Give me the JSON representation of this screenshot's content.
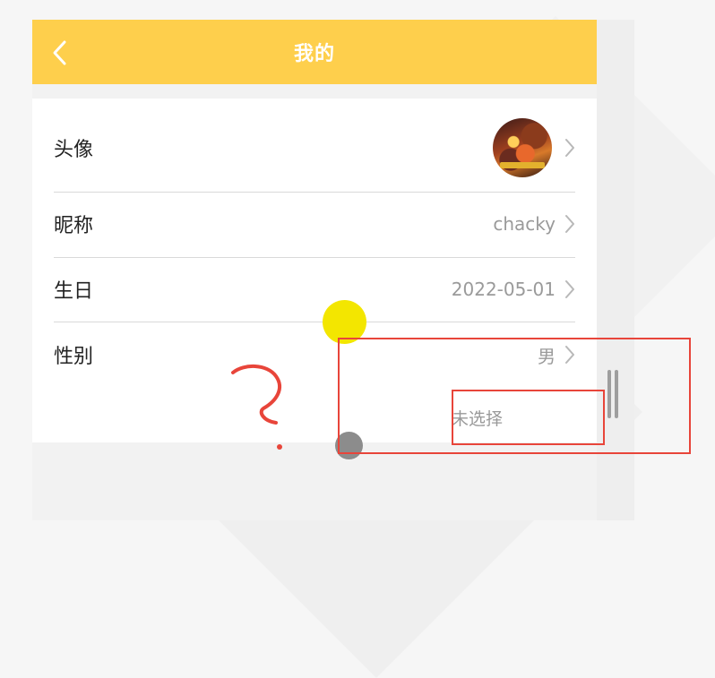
{
  "header": {
    "title": "我的",
    "back_icon": "chevron-left-icon"
  },
  "profile_rows": [
    {
      "label": "头像",
      "value": ""
    },
    {
      "label": "昵称",
      "value": "chacky"
    },
    {
      "label": "生日",
      "value": "2022-05-01"
    },
    {
      "label": "性别",
      "value": "男"
    }
  ],
  "gender_option_unselected": "未选择",
  "colors": {
    "header_bg": "#fecf4c",
    "annotation_red": "#e8453a",
    "cursor_yellow": "#f3e600"
  }
}
